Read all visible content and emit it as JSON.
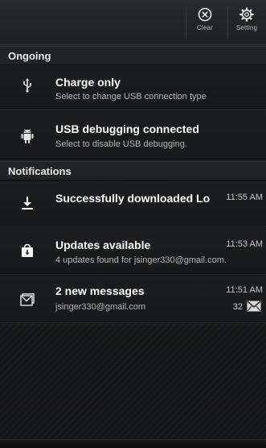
{
  "topbar": {
    "clear_label": "Clear",
    "setting_label": "Setting"
  },
  "sections": {
    "ongoing": "Ongoing",
    "notifications": "Notifications"
  },
  "ongoing": [
    {
      "icon": "usb-icon",
      "title": "Charge only",
      "subtitle": "Select to change USB connection type"
    },
    {
      "icon": "android-debug-icon",
      "title": "USB debugging connected",
      "subtitle": "Select to disable USB debugging."
    }
  ],
  "notifications": [
    {
      "icon": "download-icon",
      "title": "Successfully downloaded Lo",
      "time": "11:55 AM"
    },
    {
      "icon": "market-bag-icon",
      "title": "Updates available",
      "time": "11:53 AM",
      "subtitle": "4 updates found for jsinger330@gmail.com."
    },
    {
      "icon": "gmail-icon",
      "title": "2 new messages",
      "time": "11:51 AM",
      "subtitle": "jsinger330@gmail.com",
      "count": "32"
    }
  ],
  "colors": {
    "background": "#161718",
    "text_primary": "#ffffff",
    "text_secondary": "#b4b4b4"
  }
}
